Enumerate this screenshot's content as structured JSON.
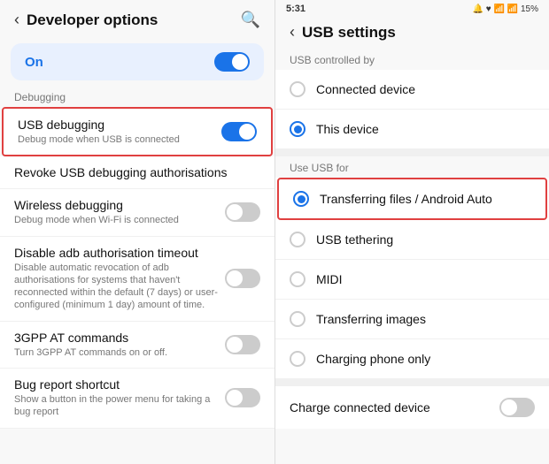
{
  "left": {
    "header": {
      "back_label": "‹",
      "title": "Developer options",
      "search_icon": "🔍"
    },
    "on_toggle": {
      "label": "On",
      "state": "on"
    },
    "debugging_label": "Debugging",
    "items": [
      {
        "id": "usb-debugging",
        "title": "USB debugging",
        "subtitle": "Debug mode when USB is connected",
        "has_toggle": true,
        "toggle_state": "on",
        "outlined": true
      },
      {
        "id": "revoke-usb",
        "title": "Revoke USB debugging authorisations",
        "subtitle": "",
        "has_toggle": false,
        "outlined": false
      },
      {
        "id": "wireless-debugging",
        "title": "Wireless debugging",
        "subtitle": "Debug mode when Wi-Fi is connected",
        "has_toggle": true,
        "toggle_state": "off",
        "outlined": false
      },
      {
        "id": "disable-adb",
        "title": "Disable adb authorisation timeout",
        "subtitle": "Disable automatic revocation of adb authorisations for systems that haven't reconnected within the default (7 days) or user-configured (minimum 1 day) amount of time.",
        "has_toggle": true,
        "toggle_state": "off",
        "outlined": false
      },
      {
        "id": "3gpp",
        "title": "3GPP AT commands",
        "subtitle": "Turn 3GPP AT commands on or off.",
        "has_toggle": true,
        "toggle_state": "off",
        "outlined": false
      },
      {
        "id": "bug-report",
        "title": "Bug report shortcut",
        "subtitle": "Show a button in the power menu for taking a bug report",
        "has_toggle": true,
        "toggle_state": "off",
        "outlined": false
      }
    ]
  },
  "right": {
    "status_bar": {
      "time": "5:31",
      "icons": "🔔 ♥ 📶 📶 15%"
    },
    "header": {
      "back_label": "‹",
      "title": "USB settings"
    },
    "controlled_by_label": "USB controlled by",
    "controlled_by_options": [
      {
        "id": "connected-device",
        "label": "Connected device",
        "selected": false
      },
      {
        "id": "this-device",
        "label": "This device",
        "selected": true
      }
    ],
    "use_usb_label": "Use USB for",
    "use_usb_options": [
      {
        "id": "transferring-files",
        "label": "Transferring files / Android Auto",
        "selected": true,
        "outlined": true
      },
      {
        "id": "usb-tethering",
        "label": "USB tethering",
        "selected": false,
        "outlined": false
      },
      {
        "id": "midi",
        "label": "MIDI",
        "selected": false,
        "outlined": false
      },
      {
        "id": "transferring-images",
        "label": "Transferring images",
        "selected": false,
        "outlined": false
      },
      {
        "id": "charging-only",
        "label": "Charging phone only",
        "selected": false,
        "outlined": false
      }
    ],
    "charge_connected": {
      "label": "Charge connected device",
      "toggle_state": "off"
    }
  }
}
